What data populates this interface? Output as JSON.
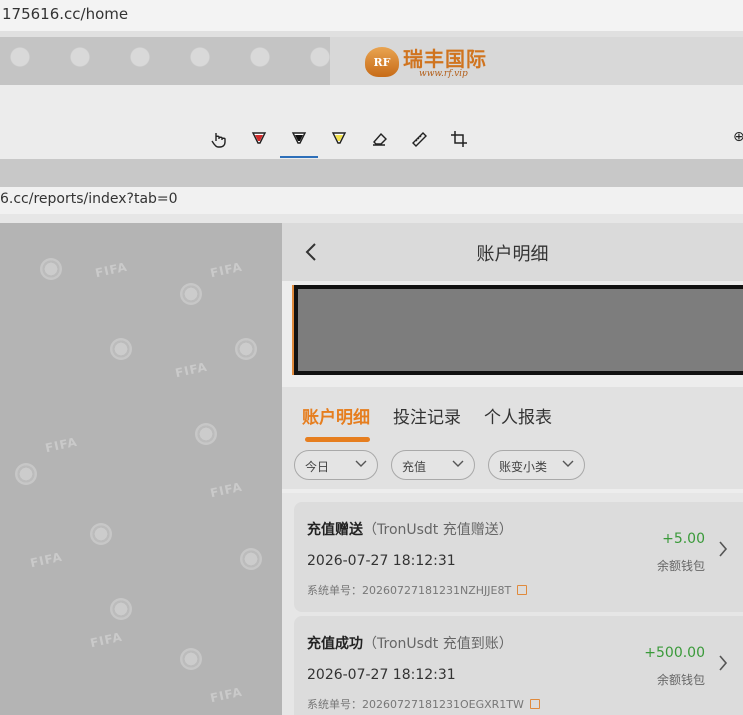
{
  "browser": {
    "url_top": "175616.cc/home",
    "url_second": "6.cc/reports/index?tab=0"
  },
  "banner": {
    "logo_badge": "RF",
    "logo_name": "瑞丰国际",
    "logo_site": "www.rf.vip"
  },
  "toolbar": {
    "tools": [
      "touch-write-icon",
      "red-pen-icon",
      "black-pen-icon",
      "highlighter-icon",
      "eraser-icon",
      "ruler-icon",
      "crop-icon"
    ],
    "more_glyph": "⊕",
    "accent": "#2d6fb9"
  },
  "panel": {
    "title": "账户明细",
    "tabs": [
      {
        "label": "账户明细",
        "active": true
      },
      {
        "label": "投注记录",
        "active": false
      },
      {
        "label": "个人报表",
        "active": false
      }
    ],
    "filters": [
      "今日",
      "充值",
      "账变小类"
    ],
    "accent": "#e67e1f",
    "records": [
      {
        "type": "充值赠送",
        "detail": "（TronUsdt 充值赠送）",
        "time": "2026-07-27 18:12:31",
        "order_label": "系统单号：",
        "order_no": "20260727181231NZHJJE8T",
        "amount": "+5.00",
        "wallet": "余额钱包"
      },
      {
        "type": "充值成功",
        "detail": "（TronUsdt 充值到账）",
        "time": "2026-07-27 18:12:31",
        "order_label": "系统单号：",
        "order_no": "20260727181231OEGXR1TW",
        "amount": "+500.00",
        "wallet": "余额钱包"
      }
    ]
  }
}
